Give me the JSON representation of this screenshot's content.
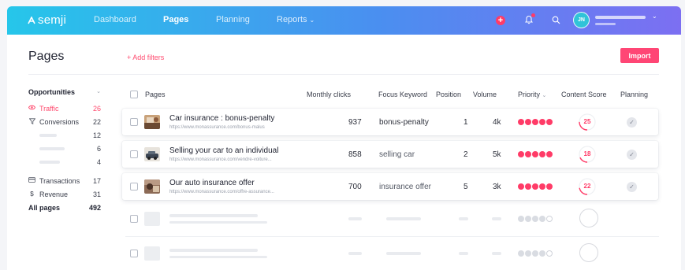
{
  "app": {
    "name": "semji"
  },
  "nav": {
    "links": [
      {
        "label": "Dashboard",
        "active": false
      },
      {
        "label": "Pages",
        "active": true
      },
      {
        "label": "Planning",
        "active": false
      },
      {
        "label": "Reports",
        "active": false,
        "has_dropdown": true
      }
    ],
    "user_initials": "JN",
    "icons": [
      "add-icon",
      "bell-icon",
      "search-icon",
      "chevron-down-icon"
    ]
  },
  "header": {
    "title": "Pages",
    "add_filters_label": "+ Add filters",
    "import_label": "Import"
  },
  "sidebar": {
    "section_title": "Opportunities",
    "items": [
      {
        "label": "Traffic",
        "count": "26",
        "icon": "eye-icon",
        "active": true
      },
      {
        "label": "Conversions",
        "count": "22",
        "icon": "filter-icon",
        "active": false
      },
      {
        "label": "",
        "count": "12",
        "placeholder": true
      },
      {
        "label": "",
        "count": "6",
        "placeholder": true
      },
      {
        "label": "",
        "count": "4",
        "placeholder": true
      },
      {
        "label": "Transactions",
        "count": "17",
        "icon": "card-icon",
        "active": false
      },
      {
        "label": "Revenue",
        "count": "31",
        "icon": "dollar-icon",
        "active": false
      }
    ],
    "all_pages_label": "All pages",
    "all_pages_count": "492"
  },
  "table": {
    "columns": [
      "Pages",
      "Monthly clicks",
      "Focus Keyword",
      "Position",
      "Volume",
      "Priority",
      "Content Score",
      "Planning"
    ],
    "rows": [
      {
        "title": "Car insurance : bonus-penalty",
        "url": "https://www.monassurance.com/bonus-malus",
        "clicks": "937",
        "keyword": "bonus-penalty",
        "position": "1",
        "volume": "4k",
        "priority": 5,
        "score": "25",
        "score_value": 25,
        "planned": true,
        "accent_color": "#ff3b67"
      },
      {
        "title": "Selling your car to an individual",
        "url": "https://www.monassurance.com/vendre-voiture...",
        "clicks": "858",
        "keyword": "selling car",
        "position": "2",
        "volume": "5k",
        "priority": 5,
        "score": "18",
        "score_value": 18,
        "planned": true,
        "accent_color": "#ff3b67"
      },
      {
        "title": "Our auto insurance offer",
        "url": "https://www.monassurance.com/offre-assurance...",
        "clicks": "700",
        "keyword": "insurance offer",
        "position": "5",
        "volume": "3k",
        "priority": 5,
        "score": "22",
        "score_value": 22,
        "planned": true,
        "accent_color": "#ff3b67"
      }
    ]
  },
  "colors": {
    "accent": "#ff3b67",
    "nav_gradient_start": "#26c6ea",
    "nav_gradient_end": "#7c6ff2"
  }
}
